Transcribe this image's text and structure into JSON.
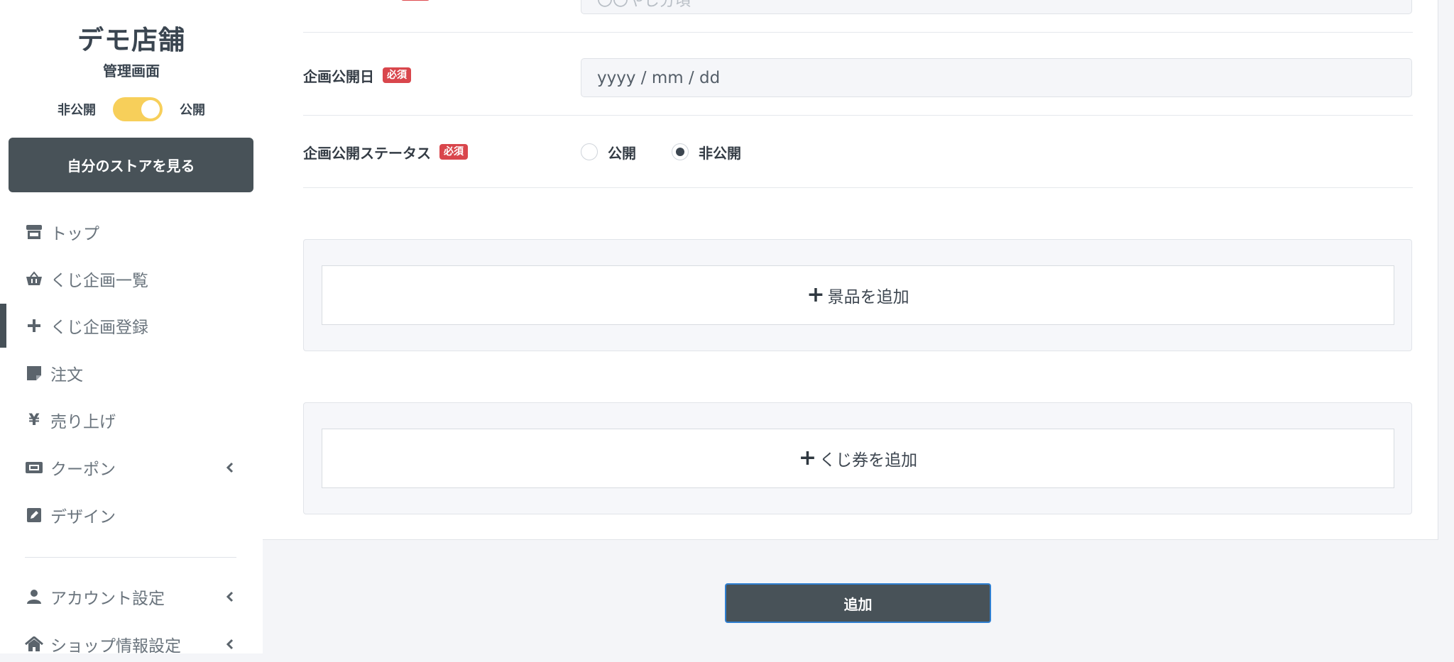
{
  "sidebar": {
    "shop_name": "デモ店舗",
    "subtitle": "管理画面",
    "toggle": {
      "off_label": "非公開",
      "on_label": "公開",
      "state": "on"
    },
    "store_button": "自分のストアを見る",
    "nav": [
      {
        "label": "トップ",
        "icon": "store-icon"
      },
      {
        "label": "くじ企画一覧",
        "icon": "basket-icon"
      },
      {
        "label": "くじ企画登録",
        "icon": "plus-icon",
        "active": true
      },
      {
        "label": "注文",
        "icon": "note-icon"
      },
      {
        "label": "売り上げ",
        "icon": "yen-icon"
      },
      {
        "label": "クーポン",
        "icon": "ticket-icon",
        "expandable": true
      },
      {
        "label": "デザイン",
        "icon": "edit-icon"
      },
      {
        "label": "アカウント設定",
        "icon": "user-icon",
        "expandable": true
      },
      {
        "label": "ショップ情報設定",
        "icon": "home-icon",
        "expandable": true
      }
    ]
  },
  "form": {
    "required_badge": "必須",
    "top_placeholder": "〇〇やじ分頃",
    "publish_date": {
      "label": "企画公開日",
      "placeholder": "yyyy / mm / dd"
    },
    "publish_status": {
      "label": "企画公開ステータス",
      "options": [
        {
          "label": "公開",
          "checked": false
        },
        {
          "label": "非公開",
          "checked": true
        }
      ]
    },
    "add_prize": "景品を追加",
    "add_ticket": "くじ券を追加",
    "submit": "追加"
  },
  "colors": {
    "accent_dark": "#485258",
    "toggle_on": "#f7cf5a",
    "required_red": "#d9464c",
    "focus_blue": "#2f7fd1"
  }
}
